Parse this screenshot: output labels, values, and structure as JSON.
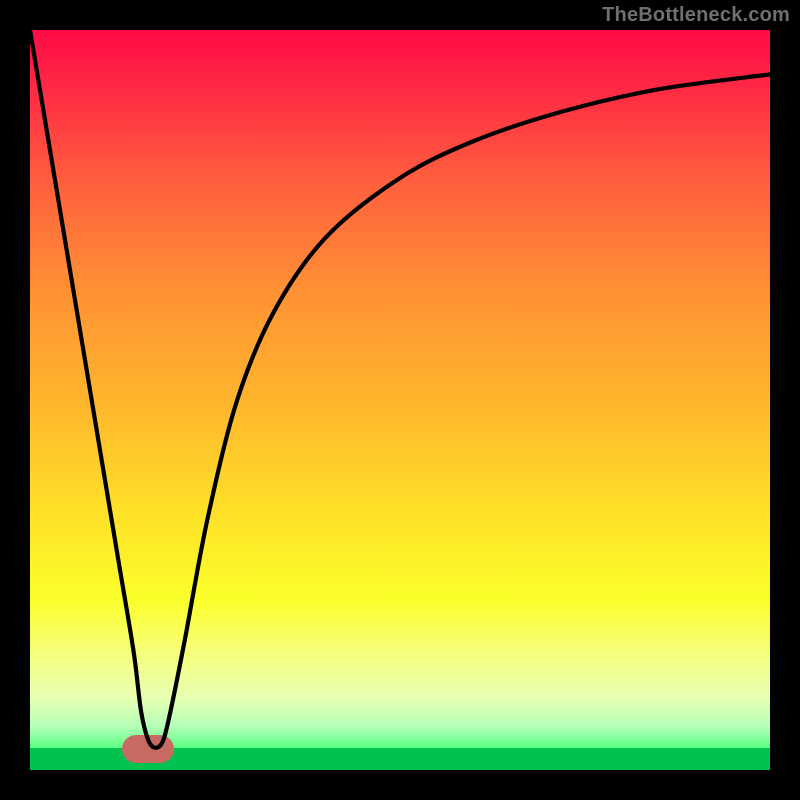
{
  "watermark": "TheBottleneck.com",
  "chart_data": {
    "type": "line",
    "title": "",
    "xlabel": "",
    "ylabel": "",
    "xlim": [
      0,
      100
    ],
    "ylim": [
      0,
      100
    ],
    "grid": false,
    "series": [
      {
        "name": "curve",
        "x": [
          0,
          4,
          7,
          10,
          12,
          14,
          15,
          16,
          17,
          18,
          19,
          21,
          24,
          28,
          33,
          40,
          50,
          60,
          72,
          85,
          100
        ],
        "y": [
          100,
          76,
          58,
          40,
          28,
          16,
          8,
          4,
          3,
          4,
          8,
          18,
          34,
          50,
          62,
          72,
          80,
          85,
          89,
          92,
          94
        ]
      }
    ],
    "blob": {
      "x": 16,
      "y": 2.8
    }
  },
  "colors": {
    "black": "#000000",
    "curve": "#000000",
    "blob": "#c76a64",
    "gradient_top": "#ff0b46",
    "gradient_bottom": "#00c24e"
  }
}
